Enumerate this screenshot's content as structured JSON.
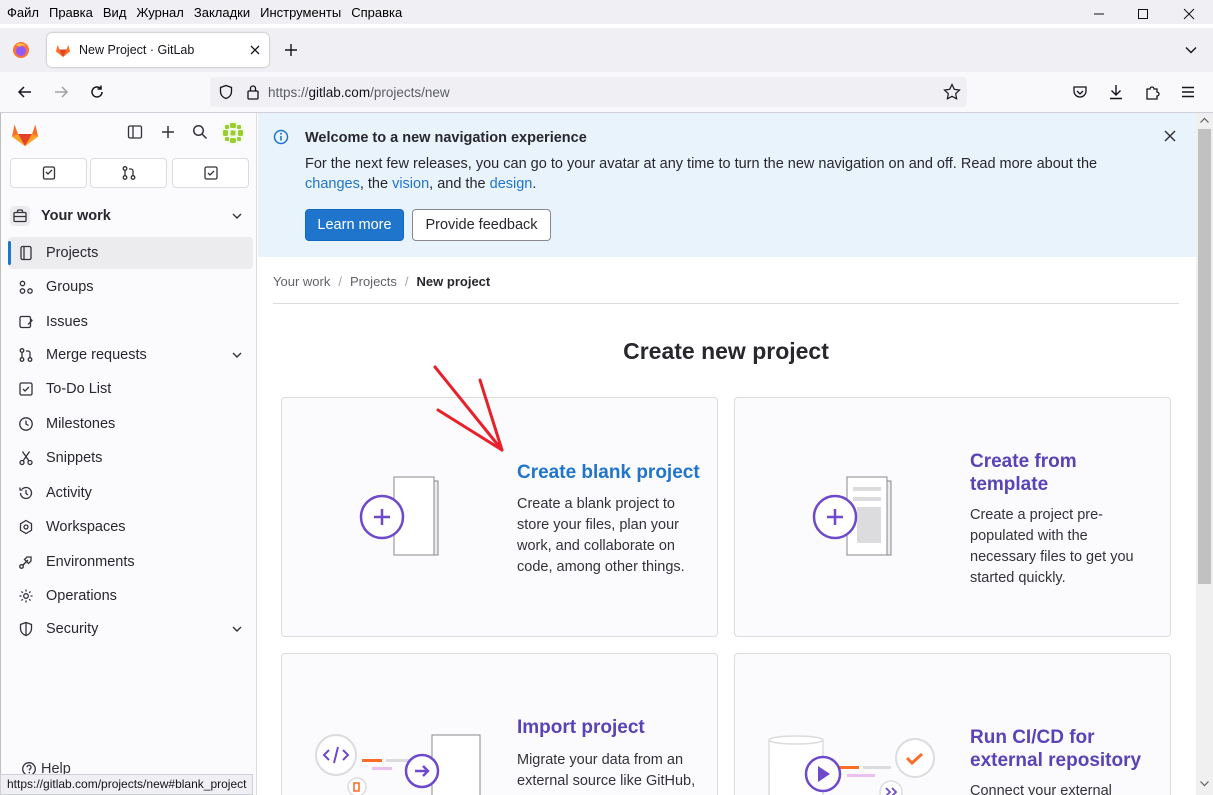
{
  "menu": [
    "Файл",
    "Правка",
    "Вид",
    "Журнал",
    "Закладки",
    "Инструменты",
    "Справка"
  ],
  "tab": {
    "title": "New Project · GitLab"
  },
  "url": {
    "prefix": "https://",
    "host": "gitlab.com",
    "path": "/projects/new"
  },
  "sidebar": {
    "context": "Your work",
    "items": [
      {
        "label": "Projects",
        "icon": "project-icon"
      },
      {
        "label": "Groups",
        "icon": "group-icon"
      },
      {
        "label": "Issues",
        "icon": "issues-icon"
      },
      {
        "label": "Merge requests",
        "icon": "merge-request-icon"
      },
      {
        "label": "To-Do List",
        "icon": "todo-icon"
      },
      {
        "label": "Milestones",
        "icon": "milestone-icon"
      },
      {
        "label": "Snippets",
        "icon": "snippet-icon"
      },
      {
        "label": "Activity",
        "icon": "history-icon"
      },
      {
        "label": "Workspaces",
        "icon": "workspace-icon"
      },
      {
        "label": "Environments",
        "icon": "environment-icon"
      },
      {
        "label": "Operations",
        "icon": "cloud-icon"
      },
      {
        "label": "Security",
        "icon": "shield-icon"
      }
    ],
    "help": "Help"
  },
  "banner": {
    "title": "Welcome to a new navigation experience",
    "body_pre": "For the next few releases, you can go to your avatar at any time to turn the new navigation on and off. Read more about the ",
    "link_changes": "changes",
    "sep1": ", the ",
    "link_vision": "vision",
    "sep2": ", and the ",
    "link_design": "design",
    "end": ".",
    "primary_button": "Learn more",
    "secondary_button": "Provide feedback"
  },
  "breadcrumb": [
    "Your work",
    "Projects",
    "New project"
  ],
  "page_title": "Create new project",
  "cards": [
    {
      "title": "Create blank project",
      "desc": "Create a blank project to store your files, plan your work, and collaborate on code, among other things."
    },
    {
      "title": "Create from template",
      "desc": "Create a project pre-populated with the necessary files to get you started quickly."
    },
    {
      "title": "Import project",
      "desc": "Migrate your data from an external source like GitHub,"
    },
    {
      "title": "Run CI/CD for external repository",
      "desc": "Connect your external"
    }
  ],
  "status_url": "https://gitlab.com/projects/new#blank_project",
  "colors": {
    "accent": "#1f75cb",
    "brand_purple": "#5943b6",
    "annotation_arrow": "#e8202a"
  }
}
